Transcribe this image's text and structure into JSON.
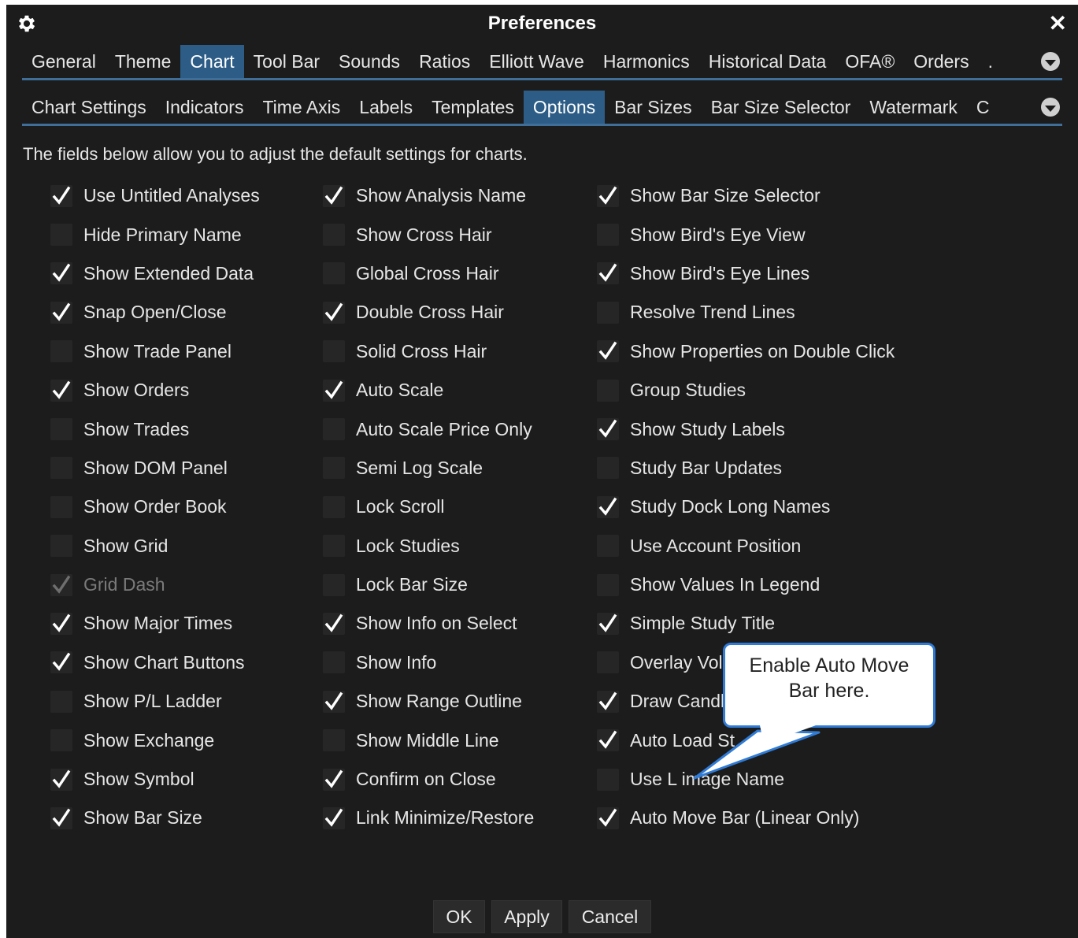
{
  "window": {
    "title": "Preferences"
  },
  "top_tabs": [
    "General",
    "Theme",
    "Chart",
    "Tool Bar",
    "Sounds",
    "Ratios",
    "Elliott Wave",
    "Harmonics",
    "Historical Data",
    "OFA®",
    "Orders",
    "."
  ],
  "top_active": "Chart",
  "sub_tabs": [
    "Chart Settings",
    "Indicators",
    "Time Axis",
    "Labels",
    "Templates",
    "Options",
    "Bar Sizes",
    "Bar Size Selector",
    "Watermark",
    "C"
  ],
  "sub_active": "Options",
  "description": "The fields below allow you to adjust the default settings for charts.",
  "columns": [
    [
      {
        "label": "Use Untitled Analyses",
        "checked": true
      },
      {
        "label": "Hide Primary Name",
        "checked": false
      },
      {
        "label": "Show Extended Data",
        "checked": true
      },
      {
        "label": "Snap Open/Close",
        "checked": true
      },
      {
        "label": "Show Trade Panel",
        "checked": false
      },
      {
        "label": "Show Orders",
        "checked": true
      },
      {
        "label": "Show Trades",
        "checked": false
      },
      {
        "label": "Show DOM Panel",
        "checked": false
      },
      {
        "label": "Show Order Book",
        "checked": false
      },
      {
        "label": "Show Grid",
        "checked": false
      },
      {
        "label": "Grid Dash",
        "checked": true,
        "disabled": true
      },
      {
        "label": "Show Major Times",
        "checked": true
      },
      {
        "label": "Show Chart Buttons",
        "checked": true
      },
      {
        "label": "Show P/L Ladder",
        "checked": false
      },
      {
        "label": "Show Exchange",
        "checked": false
      },
      {
        "label": "Show Symbol",
        "checked": true
      },
      {
        "label": "Show Bar Size",
        "checked": true
      }
    ],
    [
      {
        "label": "Show Analysis Name",
        "checked": true
      },
      {
        "label": "Show Cross Hair",
        "checked": false
      },
      {
        "label": "Global Cross Hair",
        "checked": false
      },
      {
        "label": "Double Cross Hair",
        "checked": true
      },
      {
        "label": "Solid Cross Hair",
        "checked": false
      },
      {
        "label": "Auto Scale",
        "checked": true
      },
      {
        "label": "Auto Scale Price Only",
        "checked": false
      },
      {
        "label": "Semi Log Scale",
        "checked": false
      },
      {
        "label": "Lock Scroll",
        "checked": false
      },
      {
        "label": "Lock Studies",
        "checked": false
      },
      {
        "label": "Lock Bar Size",
        "checked": false
      },
      {
        "label": "Show Info on Select",
        "checked": true
      },
      {
        "label": "Show Info",
        "checked": false
      },
      {
        "label": "Show Range Outline",
        "checked": true
      },
      {
        "label": "Show Middle Line",
        "checked": false
      },
      {
        "label": "Confirm on Close",
        "checked": true
      },
      {
        "label": "Link Minimize/Restore",
        "checked": true
      }
    ],
    [
      {
        "label": "Show Bar Size Selector",
        "checked": true
      },
      {
        "label": "Show Bird's Eye View",
        "checked": false
      },
      {
        "label": "Show Bird's Eye Lines",
        "checked": true
      },
      {
        "label": "Resolve Trend Lines",
        "checked": false
      },
      {
        "label": "Show Properties on Double Click",
        "checked": true
      },
      {
        "label": "Group Studies",
        "checked": false
      },
      {
        "label": "Show Study Labels",
        "checked": true
      },
      {
        "label": "Study Bar Updates",
        "checked": false
      },
      {
        "label": "Study Dock Long Names",
        "checked": true
      },
      {
        "label": "Use Account Position",
        "checked": false
      },
      {
        "label": "Show Values In Legend",
        "checked": false
      },
      {
        "label": "Simple Study Title",
        "checked": true
      },
      {
        "label": "Overlay Vol",
        "checked": false
      },
      {
        "label": "Draw Candl",
        "checked": true
      },
      {
        "label": "Auto Load St",
        "checked": true
      },
      {
        "label": "Use L   image Name",
        "checked": false
      },
      {
        "label": "Auto Move Bar (Linear Only)",
        "checked": true
      }
    ]
  ],
  "buttons": {
    "ok": "OK",
    "apply": "Apply",
    "cancel": "Cancel"
  },
  "callout": {
    "line1": "Enable Auto Move",
    "line2": "Bar here."
  },
  "colors": {
    "background": "#1c1c1c",
    "accent": "#2d5d86",
    "callout_border": "#2f7bd6"
  }
}
